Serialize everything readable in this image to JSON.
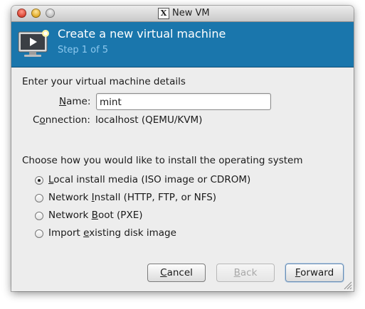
{
  "window": {
    "title": "New VM",
    "controls": [
      "close",
      "minimize",
      "maximize"
    ]
  },
  "banner": {
    "title": "Create a new virtual machine",
    "step": "Step 1 of 5",
    "icon": "monitor-play-icon",
    "background": "#1a76ac"
  },
  "details": {
    "heading": "Enter your virtual machine details",
    "name_label_u": "N",
    "name_label_rest": "ame:",
    "name_value": "mint",
    "connection_label_pre": "C",
    "connection_label_u": "o",
    "connection_label_rest": "nnection:",
    "connection_value": "localhost (QEMU/KVM)"
  },
  "install": {
    "heading": "Choose how you would like to install the operating system",
    "options": [
      {
        "pre": "",
        "u": "L",
        "rest": "ocal install media (ISO image or CDROM)",
        "checked": true
      },
      {
        "pre": "Network ",
        "u": "I",
        "rest": "nstall (HTTP, FTP, or NFS)",
        "checked": false
      },
      {
        "pre": "Network ",
        "u": "B",
        "rest": "oot (PXE)",
        "checked": false
      },
      {
        "pre": "Import ",
        "u": "e",
        "rest": "xisting disk image",
        "checked": false
      }
    ]
  },
  "buttons": {
    "cancel_u": "C",
    "cancel_rest": "ancel",
    "back_u": "B",
    "back_rest": "ack",
    "forward_u": "F",
    "forward_rest": "orward",
    "back_enabled": false
  }
}
